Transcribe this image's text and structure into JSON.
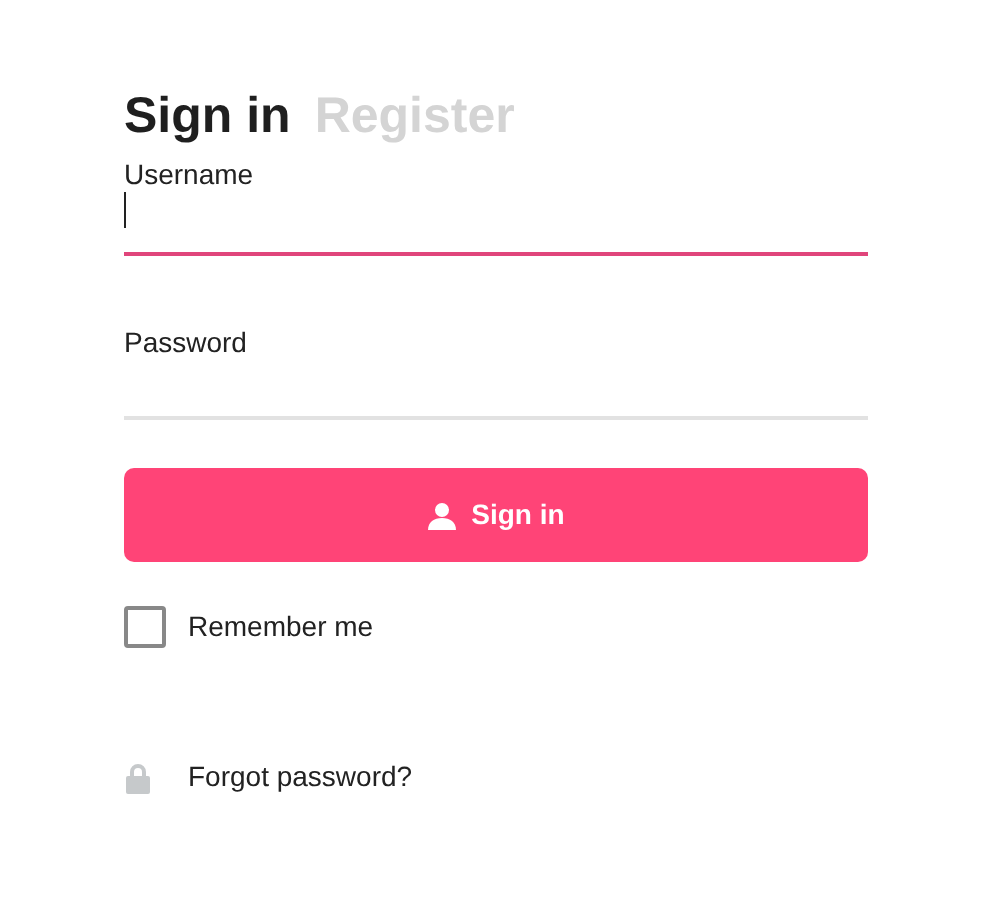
{
  "tabs": [
    {
      "label": "Sign in",
      "selected": true
    },
    {
      "label": "Register",
      "selected": false
    }
  ],
  "fields": [
    {
      "label": "Username",
      "focused": true
    },
    {
      "label": "Password",
      "focused": false
    }
  ],
  "submit": {
    "label": "Sign in"
  },
  "remember": {
    "label": "Remember me",
    "checked": false
  },
  "forgot": {
    "label": "Forgot password?"
  }
}
